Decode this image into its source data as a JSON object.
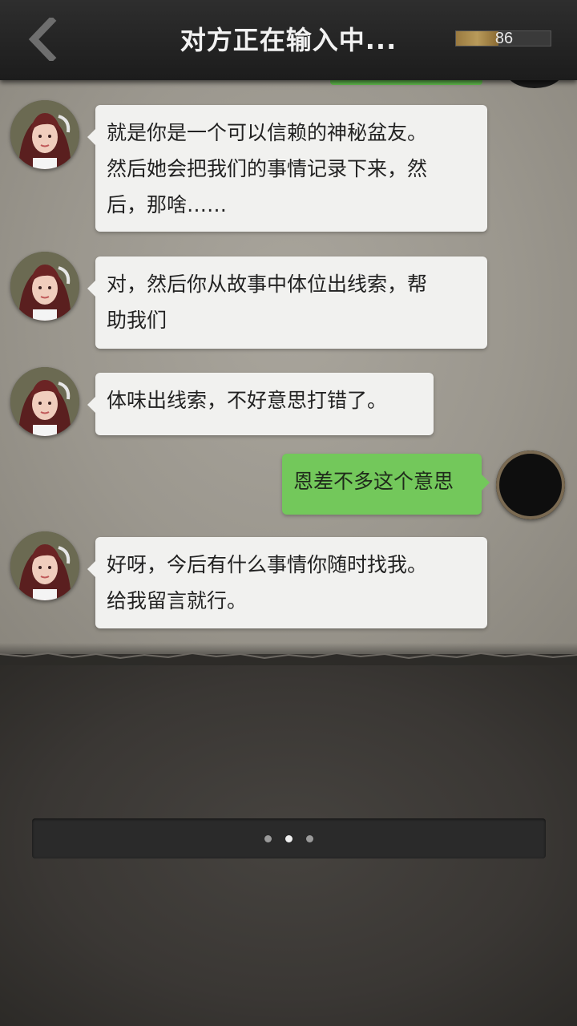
{
  "header": {
    "title": "对方正在输入中...",
    "back_icon": "chevron-left-icon",
    "progress_value": "86",
    "progress_fill_fraction": 0.45
  },
  "messages": [
    {
      "side": "left",
      "text": "就是你是一个可以信赖的神秘盆友。\n然后她会把我们的事情记录下来，然\n后，那啥……"
    },
    {
      "side": "left",
      "text": "对，然后你从故事中体位出线索，帮\n助我们"
    },
    {
      "side": "left",
      "text": "体味出线索，不好意思打错了。"
    },
    {
      "side": "right",
      "text": "恩差不多这个意思"
    },
    {
      "side": "left",
      "text": "好呀，今后有什么事情你随时找我。\n给我留言就行。"
    }
  ],
  "input_bar": {
    "dots": 3,
    "active_dot": 1
  },
  "colors": {
    "header_bg": "#262626",
    "chat_bg": "#9e9a91",
    "bubble_left": "#f1f1ef",
    "bubble_right": "#73c85b",
    "bottom_bg": "#3c3936"
  }
}
